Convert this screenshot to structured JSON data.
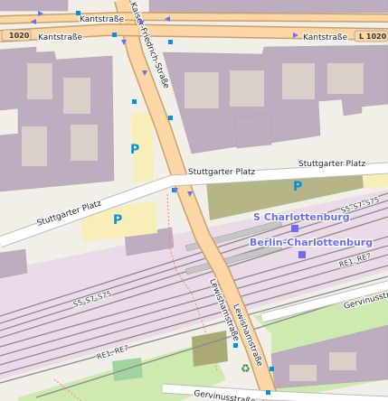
{
  "map": {
    "streets": {
      "kantstrasse_north": "Kantstraße",
      "kantstrasse_west": "Kantstraße",
      "kantstrasse_east": "Kantstraße",
      "kaiser_friedrich": "Kaiser-Friedrich-Straße",
      "stuttgarter_platz_mid": "Stuttgarter Platz",
      "stuttgarter_platz_east": "Stuttgarter Platz",
      "stuttgarter_platz_west": "Stuttgarter Platz",
      "lewishamstrasse_a": "Lewishamstraße",
      "lewishamstrasse_b": "Lewishamstraße",
      "gervinusstrasse_east": "Gervinusstraße",
      "gervinusstrasse_south": "Gervinusstraße"
    },
    "route_shields": {
      "west": "1020",
      "east": "L 1020"
    },
    "rail_labels": {
      "s_lines_east": "S5–S7–S75",
      "s_lines_west": "S5–S7–S75",
      "re_east": "RE1, RE7",
      "re_west": "RE1, RE7"
    },
    "stations": {
      "s_bahn": "S Charlottenburg",
      "db": "Berlin-Charlottenburg"
    },
    "parking": {
      "p1": "P",
      "p2": "P",
      "p3": "P"
    },
    "icons": [
      "bus-stop-icon",
      "parking-icon",
      "recycling-icon",
      "railway-station-icon"
    ],
    "colors": {
      "background": "#f2efe9",
      "building": "#beadbe",
      "primary_road": "#fcd6a4",
      "road_casing": "#c99f6c",
      "residential_road": "#ffffff",
      "parking_area": "#f7efb7",
      "green_area": "#cdebb0",
      "rail": "#999999",
      "station": "#6a6df2",
      "parking_symbol": "#0092da"
    }
  }
}
